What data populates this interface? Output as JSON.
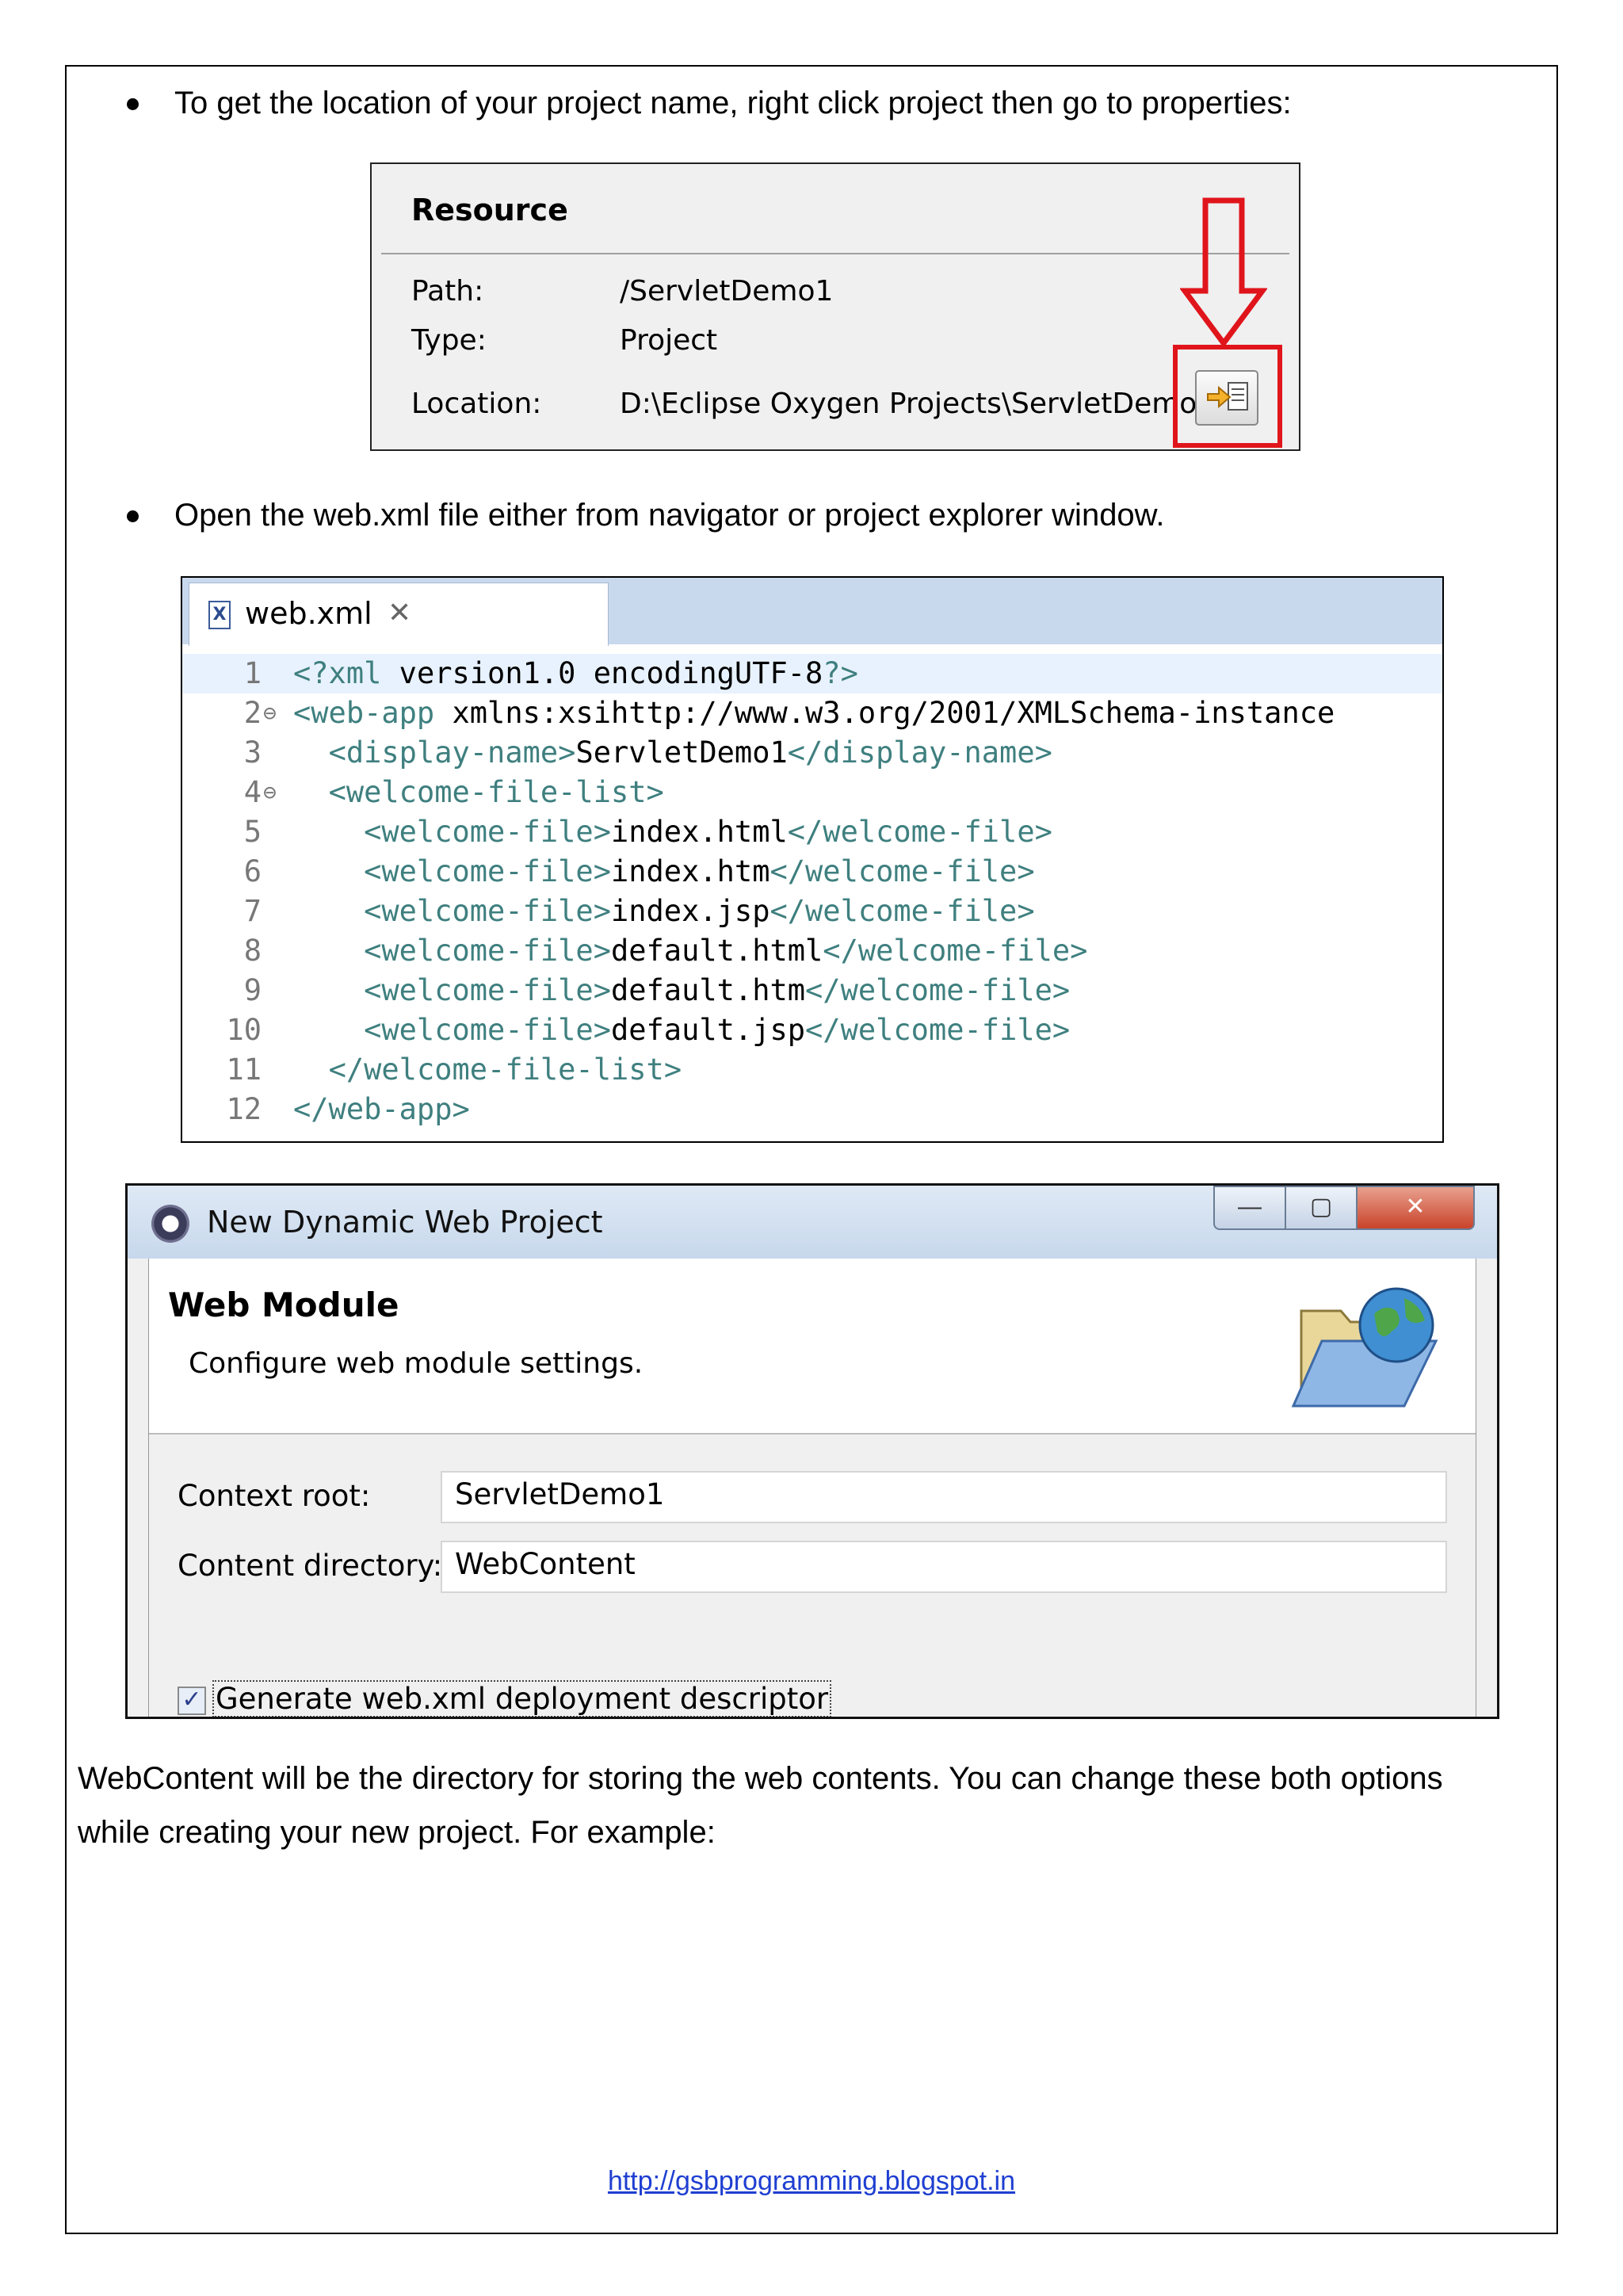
{
  "bullets": [
    "To get the location of your project name, right click project then go to properties:",
    "Open the web.xml file either from navigator or project explorer window."
  ],
  "resource_panel": {
    "title": "Resource",
    "rows": [
      {
        "label": "Path:",
        "value": "/ServletDemo1"
      },
      {
        "label": "Type:",
        "value": "Project"
      },
      {
        "label": "Location:",
        "value": "D:\\Eclipse Oxygen Projects\\ServletDemo1"
      }
    ],
    "highlight_color": "#e0151c"
  },
  "editor": {
    "tab_label": "web.xml",
    "lines": [
      {
        "n": "1",
        "code": "<?xml version=\"1.0\" encoding=\"UTF-8\"?>"
      },
      {
        "n": "2",
        "code": "<web-app xmlns:xsi=\"http://www.w3.org/2001/XMLSchema-instance\""
      },
      {
        "n": "3",
        "code": "  <display-name>ServletDemo1</display-name>"
      },
      {
        "n": "4",
        "code": "  <welcome-file-list>"
      },
      {
        "n": "5",
        "code": "    <welcome-file>index.html</welcome-file>"
      },
      {
        "n": "6",
        "code": "    <welcome-file>index.htm</welcome-file>"
      },
      {
        "n": "7",
        "code": "    <welcome-file>index.jsp</welcome-file>"
      },
      {
        "n": "8",
        "code": "    <welcome-file>default.html</welcome-file>"
      },
      {
        "n": "9",
        "code": "    <welcome-file>default.htm</welcome-file>"
      },
      {
        "n": "10",
        "code": "    <welcome-file>default.jsp</welcome-file>"
      },
      {
        "n": "11",
        "code": "  </welcome-file-list>"
      },
      {
        "n": "12",
        "code": "</web-app>"
      }
    ]
  },
  "dialog": {
    "window_title": "New Dynamic Web Project",
    "header_title": "Web Module",
    "header_desc": "Configure web module settings.",
    "context_root_label": "Context root:",
    "context_root_value": "ServletDemo1",
    "content_dir_label": "Content directory:",
    "content_dir_value": "WebContent",
    "checkbox_label": "Generate web.xml deployment descriptor",
    "checkbox_checked": true
  },
  "paragraph": "WebContent will be the directory for storing the web contents. You can change these both options while creating your new project. For example:",
  "footer_link": "http://gsbprogramming.blogspot.in"
}
